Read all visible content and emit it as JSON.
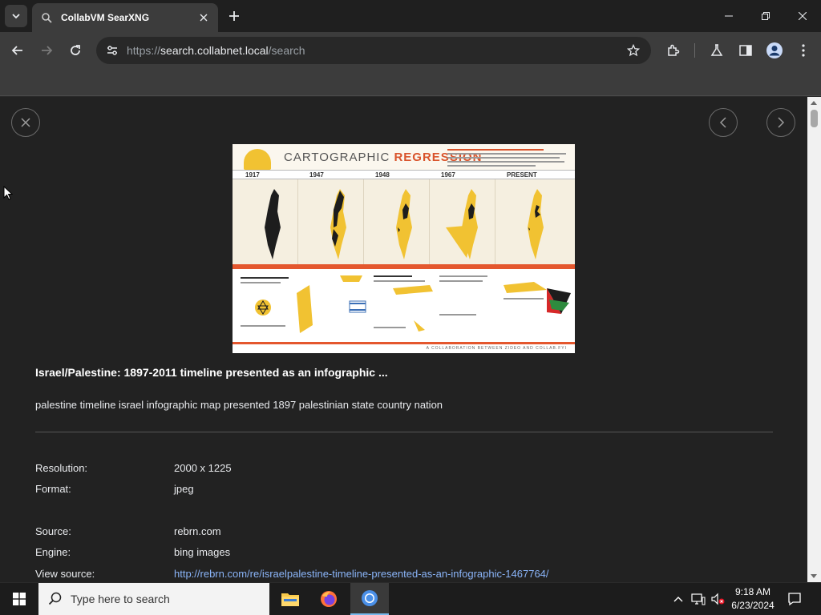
{
  "browser": {
    "tab_title": "CollabVM SearXNG",
    "url_scheme": "https://",
    "url_host": "search.collabnet.local",
    "url_path": "/search"
  },
  "preview": {
    "title_plain": "CARTOGRAPHIC ",
    "title_accent": "REGRESSION",
    "years": [
      "1917",
      "1947",
      "1948",
      "1967",
      "PRESENT"
    ],
    "credit": "A COLLABORATION BETWEEN ZIDEO AND COLLAB.FYI"
  },
  "result": {
    "title": "Israel/Palestine: 1897-2011 timeline presented as an infographic ...",
    "description": "palestine timeline israel infographic map presented 1897 palestinian state country nation",
    "resolution_label": "Resolution:",
    "resolution_value": "2000 x 1225",
    "format_label": "Format:",
    "format_value": "jpeg",
    "source_label": "Source:",
    "source_value": "rebrn.com",
    "engine_label": "Engine:",
    "engine_value": "bing images",
    "view_source_label": "View source:",
    "view_source_value": "http://rebrn.com/re/israelpalestine-timeline-presented-as-an-infographic-1467764/"
  },
  "taskbar": {
    "search_placeholder": "Type here to search",
    "time": "9:18 AM",
    "date": "6/23/2024"
  },
  "colors": {
    "accent_link": "#8ab4f8",
    "infographic_red": "#e4572e",
    "infographic_yellow": "#f1c232"
  }
}
